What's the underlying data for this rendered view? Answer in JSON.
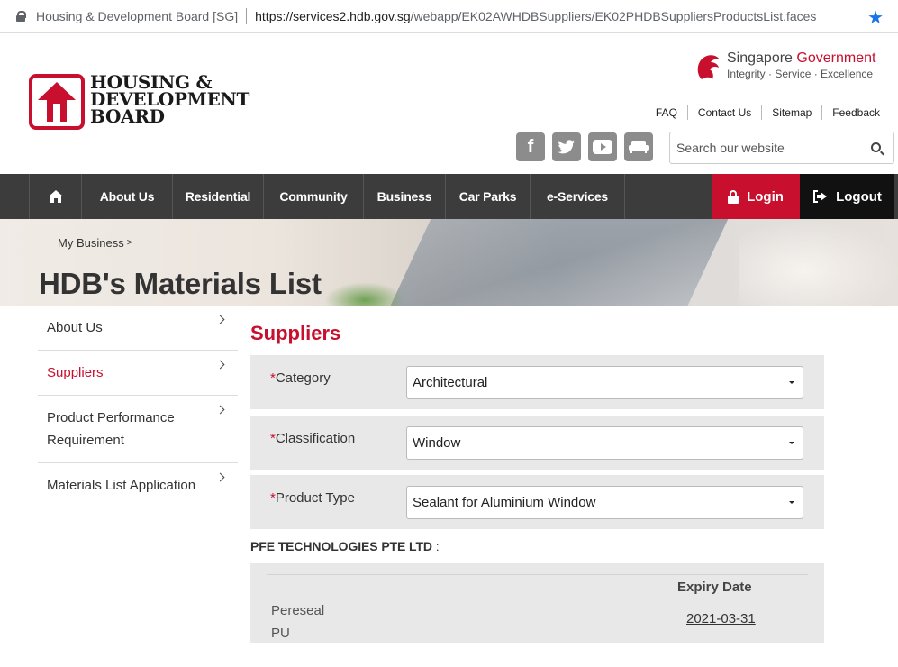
{
  "browser": {
    "site_label": "Housing & Development Board [SG]",
    "url_host": "https://services2.hdb.gov.sg",
    "url_path": "/webapp/EK02AWHDBSuppliers/EK02PHDBSuppliersProductsList.faces"
  },
  "header": {
    "logo_line1": "HOUSING &",
    "logo_line2": "DEVELOPMENT",
    "logo_line3": "BOARD",
    "sg_gov_part1": "Singapore ",
    "sg_gov_part2": "Government",
    "sg_gov_tagline": "Integrity · Service · Excellence",
    "links": [
      "FAQ",
      "Contact Us",
      "Sitemap",
      "Feedback"
    ],
    "social_icons": [
      "facebook-icon",
      "twitter-icon",
      "youtube-icon",
      "sofa-icon"
    ],
    "search_placeholder": "Search our website"
  },
  "nav": {
    "items": [
      "About Us",
      "Residential",
      "Community",
      "Business",
      "Car Parks",
      "e-Services"
    ],
    "login": "Login",
    "logout": "Logout"
  },
  "banner": {
    "breadcrumb": "My Business",
    "title": "HDB's Materials List"
  },
  "sidebar": {
    "items": [
      "About Us",
      "Suppliers",
      "Product Performance Requirement",
      "Materials List Application"
    ],
    "active_index": 1
  },
  "main": {
    "heading": "Suppliers",
    "form": [
      {
        "label": "Category",
        "value": "Architectural"
      },
      {
        "label": "Classification",
        "value": "Window"
      },
      {
        "label": "Product Type",
        "value": "Sealant for Aluminium Window"
      }
    ],
    "required_mark": "*",
    "company_name": "PFE TECHNOLOGIES PTE LTD",
    "company_suffix": " :",
    "table_header_expiry": "Expiry Date",
    "product_name": "Pereseal PU",
    "expiry_date": "2021-03-31"
  },
  "colors": {
    "brand_red": "#c8102e",
    "nav_bg": "#3c3c3c",
    "form_bg": "#e8e8e8"
  }
}
